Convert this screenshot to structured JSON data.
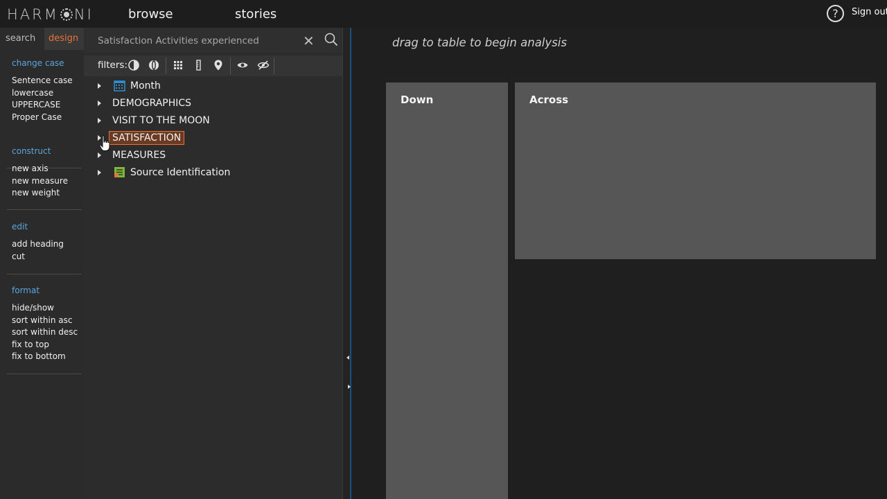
{
  "app": {
    "logo": "HARM◎NI",
    "nav": [
      "browse",
      "stories"
    ],
    "sign_out": "Sign out"
  },
  "sidebar": {
    "tabs": [
      "search",
      "design"
    ],
    "active_tab": "design",
    "sections": [
      {
        "heading": "change case",
        "items": [
          "Sentence case",
          "lowercase",
          "UPPERCASE",
          "Proper Case"
        ]
      },
      {
        "heading": "construct",
        "items": [
          "new axis",
          "new measure",
          "new weight"
        ]
      },
      {
        "heading": "edit",
        "items": [
          "add heading",
          "cut"
        ]
      },
      {
        "heading": "format",
        "items": [
          "hide/show",
          "sort within asc",
          "sort within desc",
          "fix to top",
          "fix to bottom"
        ]
      }
    ]
  },
  "panel": {
    "search_value": "Satisfaction Activities experienced",
    "filters_label": "filters:",
    "tree": [
      {
        "label": "Month",
        "icon": "calendar-icon"
      },
      {
        "label": "DEMOGRAPHICS"
      },
      {
        "label": "VISIT TO THE MOON"
      },
      {
        "label": "SATISFACTION",
        "selected": true
      },
      {
        "label": "MEASURES"
      },
      {
        "label": "Source Identification",
        "icon": "source-icon"
      }
    ]
  },
  "main": {
    "hint": "drag to table to begin analysis",
    "down_label": "Down",
    "across_label": "Across"
  },
  "colors": {
    "accent": "#e8743b",
    "link": "#5aa6e0",
    "drop_box": "#565656"
  }
}
